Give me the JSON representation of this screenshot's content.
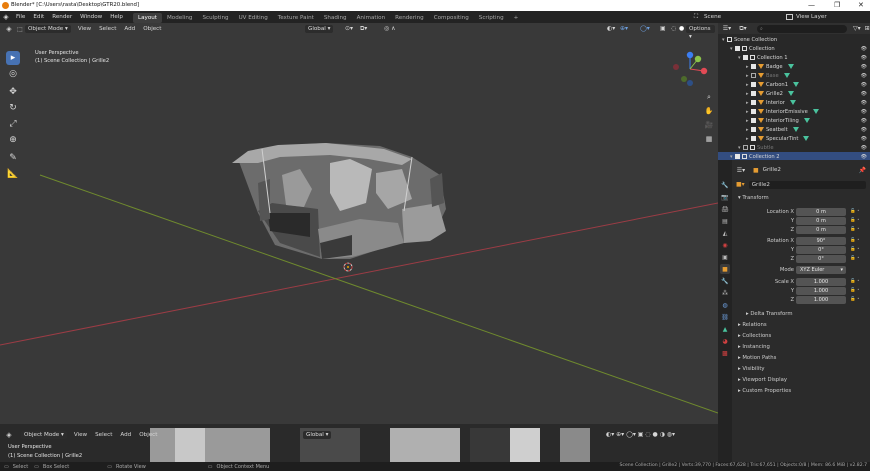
{
  "window": {
    "title": "Blender* [C:\\Users\\rasta\\Desktop\\GTR20.blend]",
    "controls": [
      "—",
      "❐",
      "✕"
    ]
  },
  "topbar": {
    "menus": [
      "File",
      "Edit",
      "Render",
      "Window",
      "Help"
    ],
    "workspaces": [
      "Layout",
      "Modeling",
      "Sculpting",
      "UV Editing",
      "Texture Paint",
      "Shading",
      "Animation",
      "Rendering",
      "Compositing",
      "Scripting"
    ],
    "add_tab": "+",
    "scene": "Scene",
    "view_layer": "View Layer"
  },
  "viewport": {
    "mode": "Object Mode",
    "menus": [
      "View",
      "Select",
      "Add",
      "Object"
    ],
    "transform_orientation": "Global",
    "options": "Options",
    "info_line1": "User Perspective",
    "info_line2": "(1) Scene Collection | Grille2",
    "gizmo_axes": [
      "X",
      "Y",
      "Z"
    ]
  },
  "bottom_viewport": {
    "mode": "Object Mode",
    "menus": [
      "View",
      "Select",
      "Add",
      "Object"
    ],
    "transform_orientation": "Global",
    "info_line1": "User Perspective",
    "info_line2": "(1) Scene Collection | Grille2"
  },
  "statusbar": {
    "items": [
      "Select",
      "Box Select",
      "Rotate View",
      "Object Context Menu"
    ],
    "stats": "Scene Collection | Grille2 | Verts:39,770 | Faces:67,628 | Tris:67,651 | Objects:0/8 | Mem: 86.6 MiB | v2.82.7"
  },
  "outliner": {
    "rows": [
      {
        "label": "Scene Collection",
        "indent": 0,
        "type": "scene"
      },
      {
        "label": "Collection",
        "indent": 1,
        "type": "collection"
      },
      {
        "label": "Collection 1",
        "indent": 2,
        "type": "collection"
      },
      {
        "label": "Badge",
        "indent": 3,
        "type": "object"
      },
      {
        "label": "Base",
        "indent": 3,
        "type": "object",
        "dim": true
      },
      {
        "label": "Carbon1",
        "indent": 3,
        "type": "object"
      },
      {
        "label": "Grille2",
        "indent": 3,
        "type": "object"
      },
      {
        "label": "Interior",
        "indent": 3,
        "type": "object"
      },
      {
        "label": "InteriorEmissive",
        "indent": 3,
        "type": "object"
      },
      {
        "label": "InteriorTiling",
        "indent": 3,
        "type": "object"
      },
      {
        "label": "Seatbelt",
        "indent": 3,
        "type": "object"
      },
      {
        "label": "SpecularTint",
        "indent": 3,
        "type": "object"
      },
      {
        "label": "Subtle",
        "indent": 2,
        "type": "collection",
        "dim": true
      },
      {
        "label": "Collection 2",
        "indent": 1,
        "type": "collection",
        "selected": true
      }
    ]
  },
  "properties": {
    "object_name": "Grille2",
    "data_name": "Grille2",
    "transform_header": "Transform",
    "location_label": "Location X",
    "location": [
      "0 m",
      "0 m",
      "0 m"
    ],
    "rotation_label": "Rotation X",
    "rotation": [
      "90°",
      "0°",
      "0°"
    ],
    "mode_label": "Mode",
    "mode_value": "XYZ Euler",
    "scale_label": "Scale X",
    "scale": [
      "1.000",
      "1.000",
      "1.000"
    ],
    "axis_y": "Y",
    "axis_z": "Z",
    "panels": [
      "Delta Transform",
      "Relations",
      "Collections",
      "Instancing",
      "Motion Paths",
      "Visibility",
      "Viewport Display",
      "Custom Properties"
    ]
  },
  "colors": {
    "accent": "#4772b3",
    "x_axis": "#e24a55",
    "y_axis": "#8bc34a",
    "z_axis": "#3c7ef2",
    "object_icon": "#e59c32",
    "modifier_icon": "#4ac39e"
  }
}
